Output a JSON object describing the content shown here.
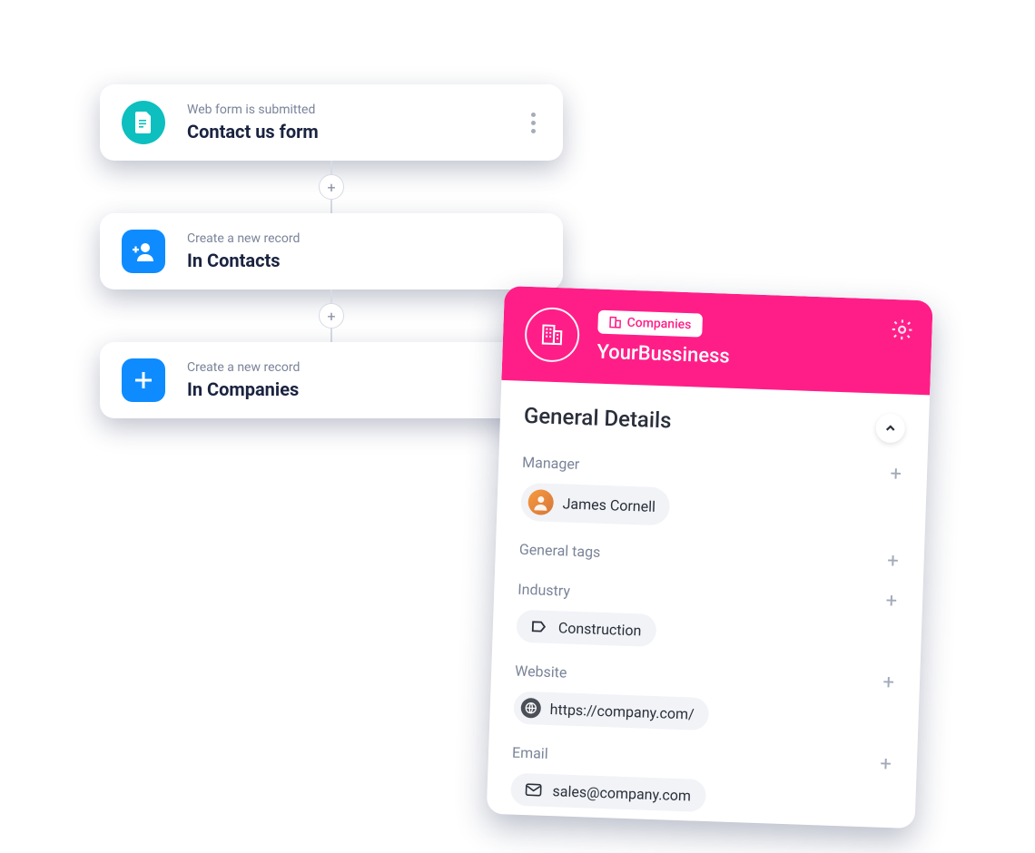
{
  "flow": {
    "steps": [
      {
        "sub": "Web form is submitted",
        "title": "Contact us form",
        "iconStyle": "teal",
        "icon": "document"
      },
      {
        "sub": "Create a new record",
        "title": "In Contacts",
        "iconStyle": "blue",
        "icon": "add-user"
      },
      {
        "sub": "Create a new record",
        "title": "In Companies",
        "iconStyle": "blue",
        "icon": "plus"
      }
    ]
  },
  "panel": {
    "badge": "Companies",
    "title": "YourBussiness",
    "section": "General Details",
    "fields": {
      "manager": {
        "label": "Manager",
        "value": "James Cornell"
      },
      "tags": {
        "label": "General tags"
      },
      "industry": {
        "label": "Industry",
        "value": "Construction"
      },
      "website": {
        "label": "Website",
        "value": "https://company.com/"
      },
      "email": {
        "label": "Email",
        "value": "sales@company.com"
      }
    }
  }
}
